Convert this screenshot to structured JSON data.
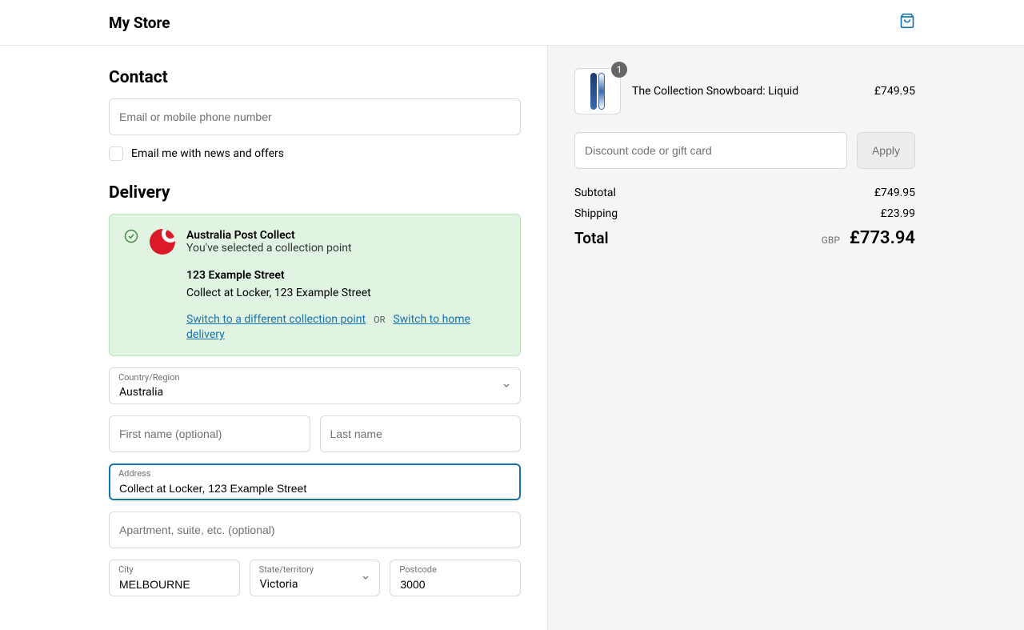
{
  "header": {
    "store_name": "My Store"
  },
  "contact": {
    "heading": "Contact",
    "email_placeholder": "Email or mobile phone number",
    "news_label": "Email me with news and offers"
  },
  "delivery": {
    "heading": "Delivery",
    "collect": {
      "title": "Australia Post Collect",
      "subtitle": "You've selected a collection point",
      "address_title": "123 Example Street",
      "address_desc": "Collect at Locker, 123 Example Street",
      "switch_point": "Switch to a different collection point",
      "or": "OR",
      "switch_home": "Switch to home delivery"
    },
    "country_label": "Country/Region",
    "country_value": "Australia",
    "first_name_placeholder": "First name (optional)",
    "last_name_placeholder": "Last name",
    "address_label": "Address",
    "address_value": "Collect at Locker, 123 Example Street",
    "apt_placeholder": "Apartment, suite, etc. (optional)",
    "city_label": "City",
    "city_value": "MELBOURNE",
    "state_label": "State/territory",
    "state_value": "Victoria",
    "postcode_label": "Postcode",
    "postcode_value": "3000"
  },
  "cart": {
    "item": {
      "name": "The Collection Snowboard: Liquid",
      "price": "£749.95",
      "qty": "1"
    },
    "discount_placeholder": "Discount code or gift card",
    "apply": "Apply",
    "subtotal_label": "Subtotal",
    "subtotal_value": "£749.95",
    "shipping_label": "Shipping",
    "shipping_value": "£23.99",
    "total_label": "Total",
    "total_currency": "GBP",
    "total_value": "£773.94"
  }
}
